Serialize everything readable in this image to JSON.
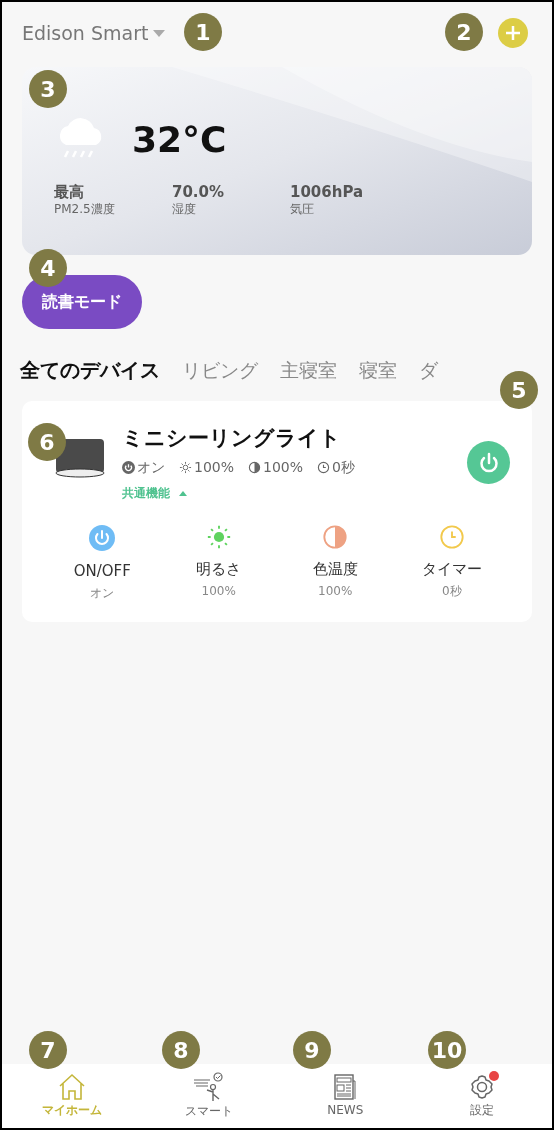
{
  "header": {
    "title": "Edison Smart"
  },
  "weather": {
    "temperature": "32°C",
    "stats": [
      {
        "value": "最高",
        "label": "PM2.5濃度"
      },
      {
        "value": "70.0%",
        "label": "湿度"
      },
      {
        "value": "1006hPa",
        "label": "気圧"
      }
    ]
  },
  "scene_button": {
    "label": "読書モード"
  },
  "room_tabs": [
    {
      "label": "全てのデバイス",
      "selected": true
    },
    {
      "label": "リビング",
      "selected": false
    },
    {
      "label": "主寝室",
      "selected": false
    },
    {
      "label": "寝室",
      "selected": false
    },
    {
      "label": "ダ",
      "selected": false
    }
  ],
  "device": {
    "name": "ミニシーリングライト",
    "on": true,
    "statuses": [
      {
        "kind": "power",
        "text": "オン"
      },
      {
        "kind": "brightness",
        "text": "100%"
      },
      {
        "kind": "color_temp",
        "text": "100%"
      },
      {
        "kind": "timer",
        "text": "0秒"
      }
    ],
    "section": {
      "label": "共通機能",
      "expanded": true
    },
    "functions": [
      {
        "kind": "power",
        "label": "ON/OFF",
        "value": "オン"
      },
      {
        "kind": "brightness",
        "label": "明るさ",
        "value": "100%"
      },
      {
        "kind": "color_temp",
        "label": "色温度",
        "value": "100%"
      },
      {
        "kind": "timer",
        "label": "タイマー",
        "value": "0秒"
      }
    ]
  },
  "bottom_nav": [
    {
      "kind": "home",
      "label": "マイホーム",
      "selected": true,
      "badge": false
    },
    {
      "kind": "smart",
      "label": "スマート",
      "selected": false,
      "badge": false
    },
    {
      "kind": "news",
      "label": "NEWS",
      "selected": false,
      "badge": false
    },
    {
      "kind": "settings",
      "label": "設定",
      "selected": false,
      "badge": true
    }
  ],
  "callouts": [
    "1",
    "2",
    "3",
    "4",
    "5",
    "6",
    "7",
    "8",
    "9",
    "10"
  ]
}
